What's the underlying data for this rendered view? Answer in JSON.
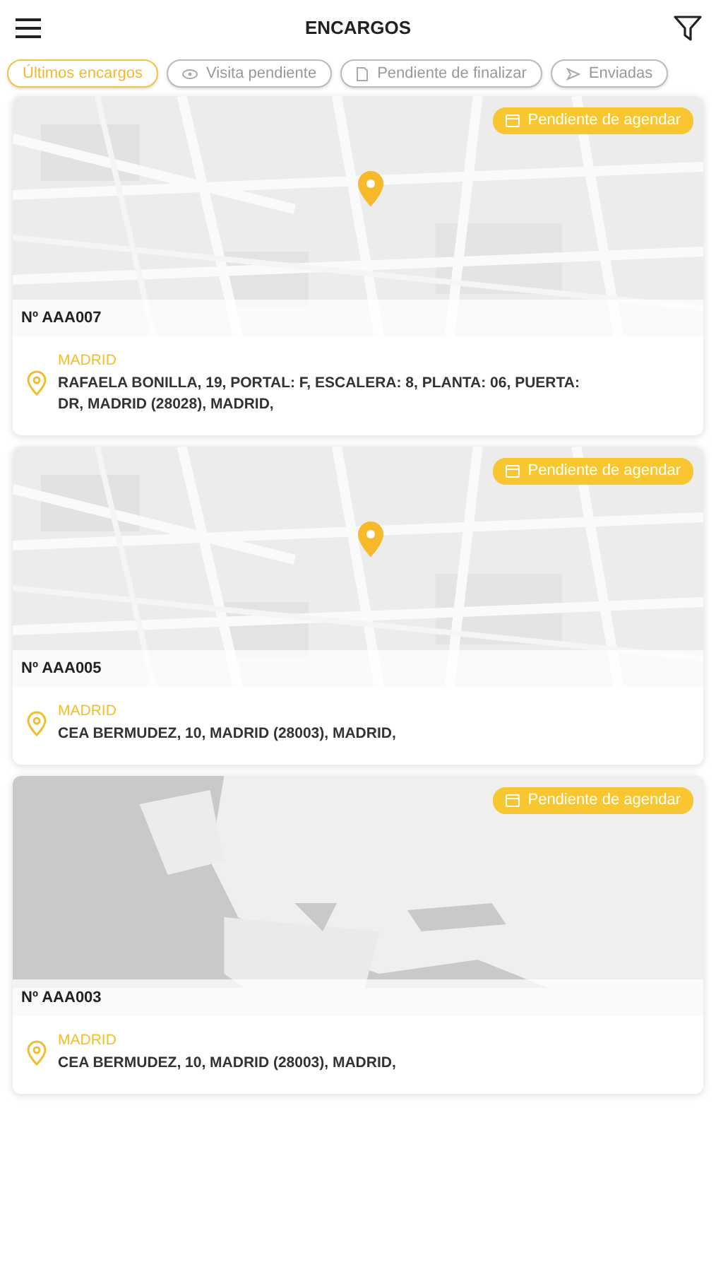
{
  "header": {
    "title": "ENCARGOS"
  },
  "filters": [
    {
      "label": "Últimos encargos",
      "kind": "plain",
      "selected": true
    },
    {
      "label": "Visita pendiente",
      "kind": "eye",
      "selected": false
    },
    {
      "label": "Pendiente de finalizar",
      "kind": "document",
      "selected": false
    },
    {
      "label": "Enviadas",
      "kind": "send",
      "selected": false
    }
  ],
  "orders": [
    {
      "number": "Nº AAA007",
      "status": "Pendiente de agendar",
      "city": "MADRID",
      "address": "RAFAELA BONILLA, 19, PORTAL: F, ESCALERA: 8, PLANTA: 06, PUERTA: DR, MADRID (28028), MADRID,",
      "pin": true
    },
    {
      "number": "Nº AAA005",
      "status": "Pendiente de agendar",
      "city": "MADRID",
      "address": "CEA BERMUDEZ, 10, MADRID (28003), MADRID,",
      "pin": true
    },
    {
      "number": "Nº AAA003",
      "status": "Pendiente de agendar",
      "city": "MADRID",
      "address": "CEA BERMUDEZ, 10, MADRID (28003), MADRID,",
      "pin": false
    }
  ]
}
